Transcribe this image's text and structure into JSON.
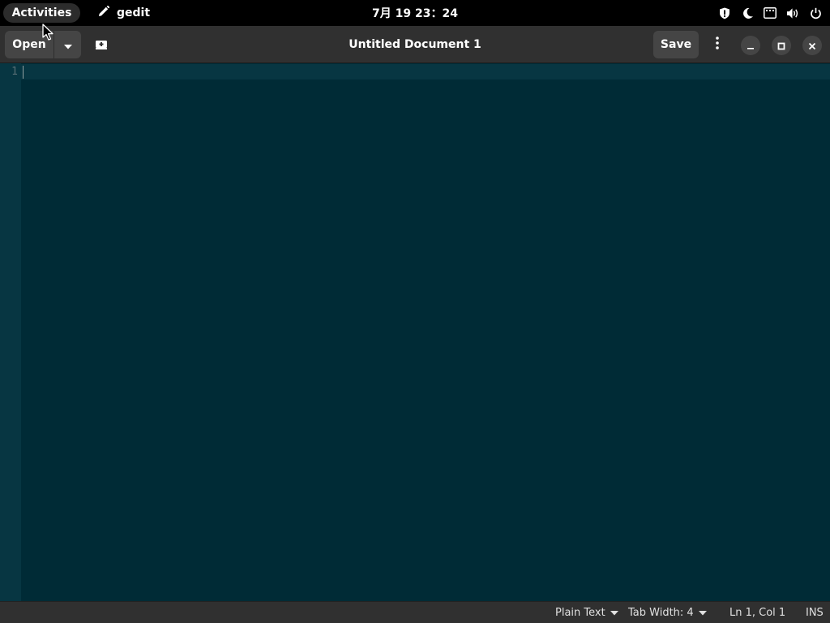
{
  "topbar": {
    "activities": "Activities",
    "app_name": "gedit",
    "clock": "7月 19  23：24",
    "tray_icons": [
      "shield-icon",
      "night-light-icon",
      "network-icon",
      "volume-icon",
      "power-icon"
    ]
  },
  "headerbar": {
    "open_label": "Open",
    "title": "Untitled Document 1",
    "save_label": "Save"
  },
  "editor": {
    "line_numbers": [
      "1"
    ],
    "content": "",
    "colors": {
      "background": "#002b36",
      "gutter": "#073642",
      "line_number": "#586e75"
    }
  },
  "statusbar": {
    "language": "Plain Text",
    "tab_width": "Tab Width: 4",
    "position": "Ln 1, Col 1",
    "mode": "INS"
  }
}
